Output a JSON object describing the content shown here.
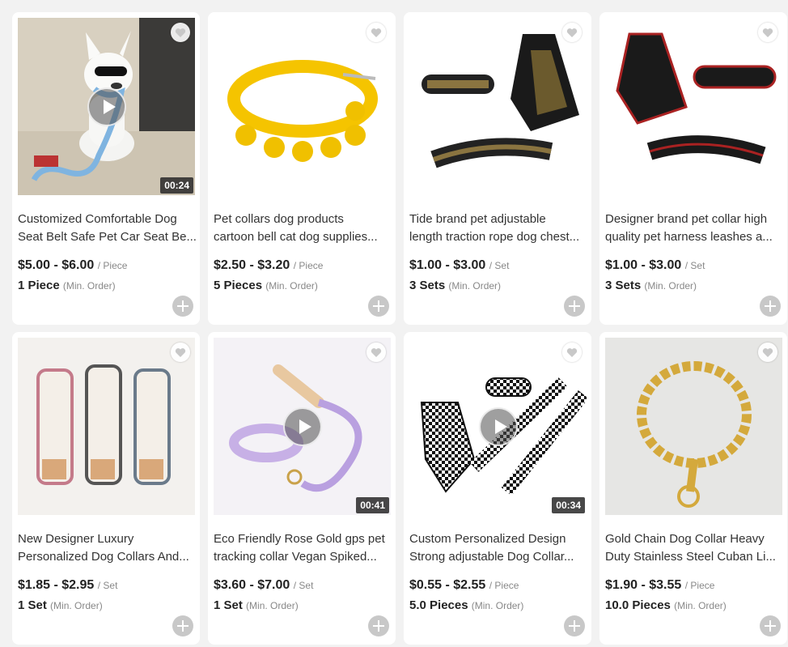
{
  "products": [
    {
      "title_line1": "Customized Comfortable Dog",
      "title_line2": "Seat Belt Safe Pet Car Seat Be...",
      "price_range": "$5.00 - $6.00",
      "price_unit": "/ Piece",
      "moq": "1 Piece",
      "moq_label": "(Min. Order)",
      "video_duration": "00:24",
      "image_icon": "white-dog-statue-with-blue-leash"
    },
    {
      "title_line1": "Pet collars dog products",
      "title_line2": "cartoon bell cat dog supplies...",
      "price_range": "$2.50 - $3.20",
      "price_unit": "/ Piece",
      "moq": "5 Pieces",
      "moq_label": "(Min. Order)",
      "image_icon": "yellow-collar-with-bells"
    },
    {
      "title_line1": "Tide brand pet adjustable",
      "title_line2": "length traction rope dog chest...",
      "price_range": "$1.00 - $3.00",
      "price_unit": "/ Set",
      "moq": "3 Sets",
      "moq_label": "(Min. Order)",
      "image_icon": "black-gold-harness-set"
    },
    {
      "title_line1": "Designer brand pet collar high",
      "title_line2": "quality pet harness leashes a...",
      "price_range": "$1.00 - $3.00",
      "price_unit": "/ Set",
      "moq": "3 Sets",
      "moq_label": "(Min. Order)",
      "image_icon": "black-red-harness-set"
    },
    {
      "title_line1": "New Designer Luxury",
      "title_line2": "Personalized Dog Collars And...",
      "price_range": "$1.85 - $2.95",
      "price_unit": "/ Set",
      "moq": "1 Set",
      "moq_label": "(Min. Order)",
      "image_icon": "patterned-collars"
    },
    {
      "title_line1": "Eco Friendly Rose Gold gps pet",
      "title_line2": "tracking collar Vegan Spiked...",
      "price_range": "$3.60 - $7.00",
      "price_unit": "/ Set",
      "moq": "1 Set",
      "moq_label": "(Min. Order)",
      "video_duration": "00:41",
      "image_icon": "lavender-rope-leash-collar"
    },
    {
      "title_line1": "Custom Personalized Design",
      "title_line2": "Strong adjustable Dog Collar...",
      "price_range": "$0.55 - $2.55",
      "price_unit": "/ Piece",
      "moq": "5.0 Pieces",
      "moq_label": "(Min. Order)",
      "video_duration": "00:34",
      "image_icon": "checkered-harness-leash"
    },
    {
      "title_line1": "Gold Chain Dog Collar Heavy",
      "title_line2": "Duty Stainless Steel Cuban Li...",
      "price_range": "$1.90 - $3.55",
      "price_unit": "/ Piece",
      "moq": "10.0 Pieces",
      "moq_label": "(Min. Order)",
      "image_icon": "gold-chain-collar"
    }
  ],
  "colors": {
    "page_bg": "#f2f2f2",
    "card_bg": "#ffffff",
    "add_button": "#c8c8c8"
  }
}
